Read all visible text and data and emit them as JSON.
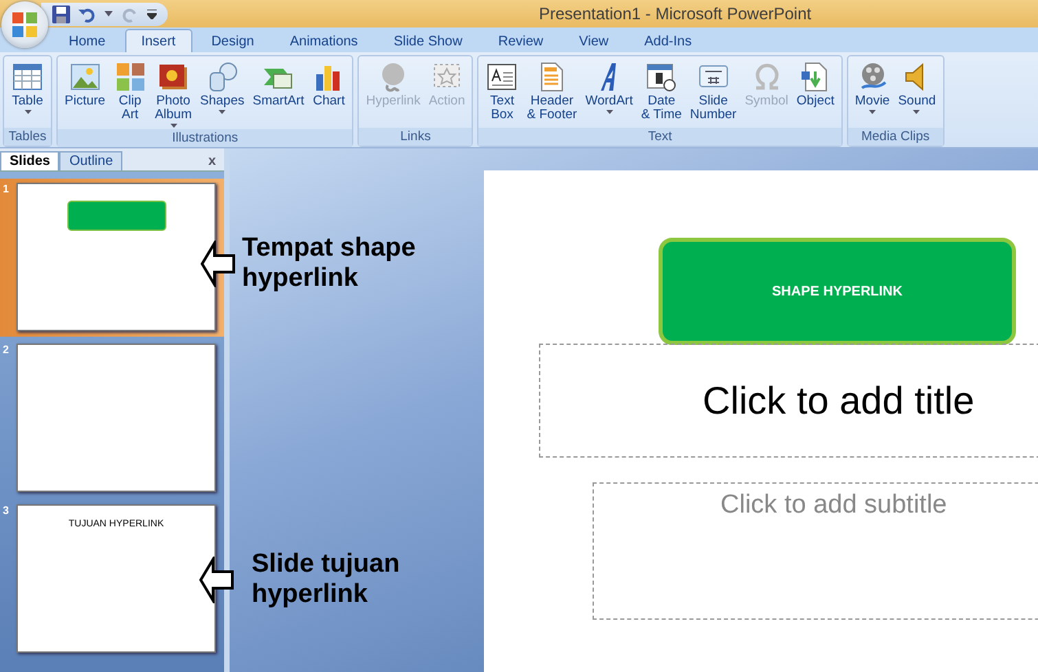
{
  "window": {
    "title": "Presentation1 - Microsoft PowerPoint"
  },
  "ribbon_tabs": [
    {
      "label": "Home",
      "selected": false
    },
    {
      "label": "Insert",
      "selected": true
    },
    {
      "label": "Design",
      "selected": false
    },
    {
      "label": "Animations",
      "selected": false
    },
    {
      "label": "Slide Show",
      "selected": false
    },
    {
      "label": "Review",
      "selected": false
    },
    {
      "label": "View",
      "selected": false
    },
    {
      "label": "Add-Ins",
      "selected": false
    }
  ],
  "ribbon_groups": [
    {
      "label": "Tables",
      "buttons": [
        {
          "lines": [
            "Table"
          ],
          "dropdown": true,
          "disabled": false
        }
      ]
    },
    {
      "label": "Illustrations",
      "buttons": [
        {
          "lines": [
            "Picture"
          ],
          "dropdown": false,
          "disabled": false
        },
        {
          "lines": [
            "Clip",
            "Art"
          ],
          "dropdown": false,
          "disabled": false
        },
        {
          "lines": [
            "Photo",
            "Album"
          ],
          "dropdown": true,
          "disabled": false
        },
        {
          "lines": [
            "Shapes"
          ],
          "dropdown": true,
          "disabled": false
        },
        {
          "lines": [
            "SmartArt"
          ],
          "dropdown": false,
          "disabled": false
        },
        {
          "lines": [
            "Chart"
          ],
          "dropdown": false,
          "disabled": false
        }
      ]
    },
    {
      "label": "Links",
      "buttons": [
        {
          "lines": [
            "Hyperlink"
          ],
          "dropdown": false,
          "disabled": true
        },
        {
          "lines": [
            "Action"
          ],
          "dropdown": false,
          "disabled": true
        }
      ]
    },
    {
      "label": "Text",
      "buttons": [
        {
          "lines": [
            "Text",
            "Box"
          ],
          "dropdown": false,
          "disabled": false
        },
        {
          "lines": [
            "Header",
            "& Footer"
          ],
          "dropdown": false,
          "disabled": false
        },
        {
          "lines": [
            "WordArt"
          ],
          "dropdown": true,
          "disabled": false
        },
        {
          "lines": [
            "Date",
            "& Time"
          ],
          "dropdown": false,
          "disabled": false
        },
        {
          "lines": [
            "Slide",
            "Number"
          ],
          "dropdown": false,
          "disabled": false
        },
        {
          "lines": [
            "Symbol"
          ],
          "dropdown": false,
          "disabled": true
        },
        {
          "lines": [
            "Object"
          ],
          "dropdown": false,
          "disabled": false
        }
      ]
    },
    {
      "label": "Media Clips",
      "buttons": [
        {
          "lines": [
            "Movie"
          ],
          "dropdown": true,
          "disabled": false
        },
        {
          "lines": [
            "Sound"
          ],
          "dropdown": true,
          "disabled": false
        }
      ]
    }
  ],
  "pane_tabs": [
    {
      "label": "Slides",
      "selected": true
    },
    {
      "label": "Outline",
      "selected": false
    }
  ],
  "pane_close": "x",
  "thumbnails": [
    {
      "number": "1",
      "selected": true,
      "kind": "shape"
    },
    {
      "number": "2",
      "selected": false,
      "kind": "blank"
    },
    {
      "number": "3",
      "selected": false,
      "kind": "title",
      "text": "TUJUAN HYPERLINK"
    }
  ],
  "slide": {
    "shape_text": "SHAPE HYPERLINK",
    "title_placeholder": "Click to add title",
    "subtitle_placeholder": "Click to add subtitle"
  },
  "annotations": [
    "Tempat shape hyperlink",
    "Slide tujuan hyperlink"
  ]
}
